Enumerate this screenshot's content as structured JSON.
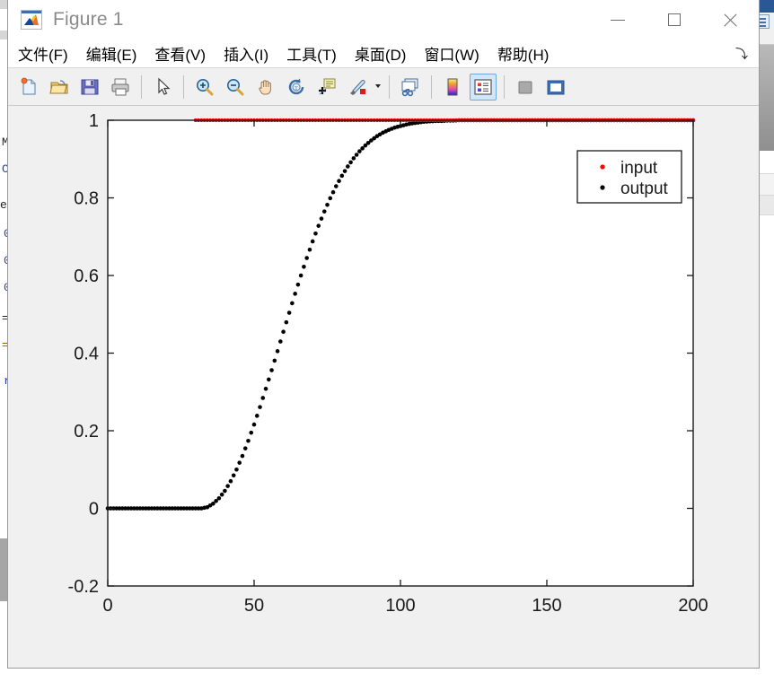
{
  "window": {
    "title": "Figure 1",
    "icon": "matlab-membrane-icon",
    "controls": {
      "minimize": "–",
      "maximize": "□",
      "close": "✕"
    }
  },
  "menubar": {
    "items": [
      {
        "label": "文件(F)"
      },
      {
        "label": "编辑(E)"
      },
      {
        "label": "查看(V)"
      },
      {
        "label": "插入(I)"
      },
      {
        "label": "工具(T)"
      },
      {
        "label": "桌面(D)"
      },
      {
        "label": "窗口(W)"
      },
      {
        "label": "帮助(H)"
      }
    ],
    "corner_icon": "⤵"
  },
  "toolbar": {
    "buttons": [
      {
        "name": "new-figure-icon",
        "tooltip": "新建图窗",
        "active": false
      },
      {
        "name": "open-file-icon",
        "tooltip": "打开文件",
        "active": false
      },
      {
        "name": "save-figure-icon",
        "tooltip": "保存图窗",
        "active": false
      },
      {
        "name": "print-figure-icon",
        "tooltip": "打印图窗",
        "active": false
      },
      {
        "name": "pointer-arrow-icon",
        "tooltip": "编辑绘图",
        "active": false
      },
      {
        "name": "zoom-in-icon",
        "tooltip": "放大",
        "active": false
      },
      {
        "name": "zoom-out-icon",
        "tooltip": "缩小",
        "active": false
      },
      {
        "name": "pan-hand-icon",
        "tooltip": "平移",
        "active": false
      },
      {
        "name": "rotate-3d-icon",
        "tooltip": "三维旋转",
        "active": false
      },
      {
        "name": "data-cursor-icon",
        "tooltip": "数据提示",
        "active": false
      },
      {
        "name": "brush-select-icon",
        "tooltip": "刷亮/选择数据",
        "active": false
      },
      {
        "name": "link-plot-icon",
        "tooltip": "链接绘图",
        "active": false
      },
      {
        "name": "colorbar-icon",
        "tooltip": "插入颜色栏",
        "active": false
      },
      {
        "name": "legend-icon",
        "tooltip": "插入图例",
        "active": true
      },
      {
        "name": "hide-plot-tools-icon",
        "tooltip": "隐藏绘图工具",
        "active": false
      },
      {
        "name": "show-plot-tools-icon",
        "tooltip": "显示绘图工具",
        "active": false
      }
    ]
  },
  "chart_data": {
    "type": "scatter",
    "title": "",
    "xlabel": "",
    "ylabel": "",
    "xlim": [
      0,
      200
    ],
    "ylim": [
      -0.2,
      1.0
    ],
    "xticks": [
      0,
      50,
      100,
      150,
      200
    ],
    "yticks": [
      -0.2,
      0,
      0.2,
      0.4,
      0.6,
      0.8,
      1
    ],
    "xticklabels": [
      "0",
      "50",
      "100",
      "150",
      "200"
    ],
    "yticklabels": [
      "-0.2",
      "0",
      "0.2",
      "0.4",
      "0.6",
      "0.8",
      "1"
    ],
    "grid": false,
    "box": true,
    "legend": {
      "position": "north-east-inside",
      "entries": [
        {
          "label": "input",
          "color": "#ff0000",
          "marker": "dot"
        },
        {
          "label": "output",
          "color": "#000000",
          "marker": "dot"
        }
      ]
    },
    "series": [
      {
        "name": "input",
        "color": "#ff0000",
        "marker": "dot",
        "description": "Unit step reference: 0 for x<30, then constant 1 drawn from x=30 to x=200",
        "step_start_x": 30,
        "step_level": 1,
        "x_range": [
          30,
          200
        ],
        "sample_step": 1
      },
      {
        "name": "output",
        "color": "#000000",
        "marker": "dot",
        "description": "System step response: flat 0 until x≈33, sigmoid S-shaped rise, saturating at 1 near x≈118",
        "sample_step": 1,
        "x": [
          0,
          2,
          4,
          6,
          8,
          10,
          12,
          14,
          16,
          18,
          20,
          22,
          24,
          26,
          28,
          30,
          32,
          34,
          36,
          38,
          40,
          42,
          44,
          46,
          48,
          50,
          52,
          54,
          56,
          58,
          60,
          62,
          64,
          66,
          68,
          70,
          72,
          74,
          76,
          78,
          80,
          82,
          84,
          86,
          88,
          90,
          92,
          94,
          96,
          98,
          100,
          102,
          104,
          106,
          108,
          110,
          112,
          114,
          116,
          118,
          120,
          125,
          130,
          135,
          140,
          145,
          150,
          155,
          160,
          165,
          170,
          175,
          180,
          185,
          190,
          195,
          200
        ],
        "y": [
          0,
          0,
          0,
          0,
          0,
          0,
          0,
          0,
          0,
          0,
          0,
          0,
          0,
          0,
          0,
          0,
          0,
          0.003,
          0.012,
          0.026,
          0.045,
          0.07,
          0.1,
          0.135,
          0.174,
          0.216,
          0.261,
          0.308,
          0.356,
          0.405,
          0.455,
          0.504,
          0.553,
          0.6,
          0.645,
          0.688,
          0.728,
          0.765,
          0.799,
          0.83,
          0.857,
          0.881,
          0.902,
          0.92,
          0.935,
          0.948,
          0.959,
          0.968,
          0.975,
          0.981,
          0.985,
          0.989,
          0.992,
          0.994,
          0.996,
          0.997,
          0.998,
          0.998,
          0.999,
          0.999,
          1.0,
          1.0,
          1.0,
          1.0,
          1.0,
          1.0,
          1.0,
          1.0,
          1.0,
          1.0,
          1.0,
          1.0,
          1.0,
          1.0,
          1.0,
          1.0,
          1.0
        ]
      }
    ]
  },
  "background": {
    "left_app": "matlab-editor-window",
    "right_app": "matlab-desktop-window"
  }
}
